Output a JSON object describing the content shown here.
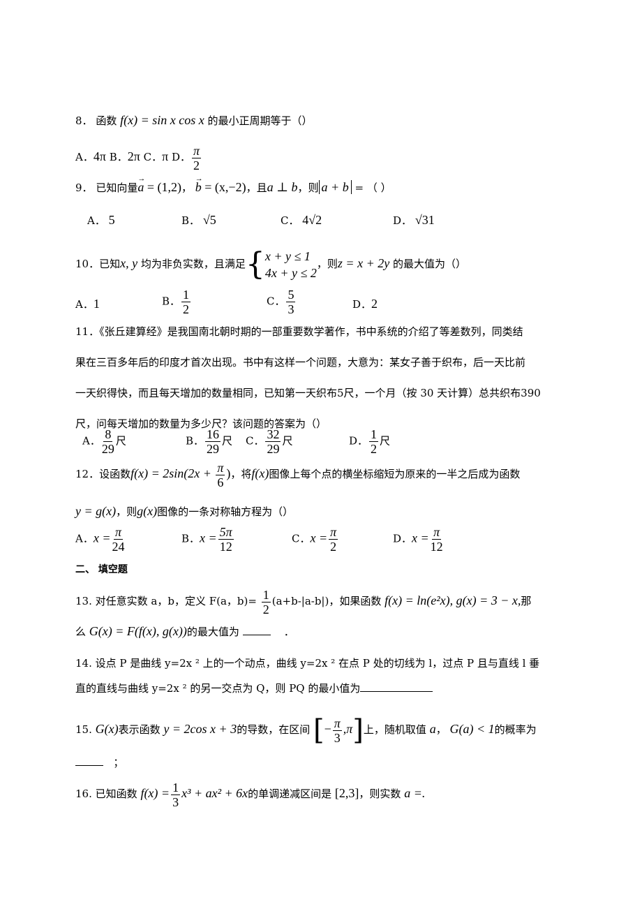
{
  "questions": {
    "q8": {
      "number": "8．",
      "stem_pre": "函数",
      "formula": "f(x) = sin x cos x",
      "stem_post": "的最小正周期等于（）",
      "options": [
        {
          "label": "A．",
          "value": "4π"
        },
        {
          "label": "B．",
          "value": "2π"
        },
        {
          "label": "C．",
          "value": "π"
        },
        {
          "label": "D．",
          "num": "π",
          "den": "2"
        }
      ]
    },
    "q9": {
      "number": "9．",
      "stem_pre": "已知向量",
      "vec_a": "a",
      "vec_a_val": " = (1,2)",
      "sep1": "，",
      "vec_b": "b",
      "vec_b_val": " = (x,−2)",
      "cond_pre": "，且",
      "cond": "a ⊥ b",
      "cond_post": "，则",
      "abs_expr": "a + b",
      "stem_post": " = （        ）",
      "options": [
        {
          "label": "A．",
          "value": "5"
        },
        {
          "label": "B．",
          "value": "√5"
        },
        {
          "label": "C．",
          "value": "4√2"
        },
        {
          "label": "D．",
          "value": "√31"
        }
      ]
    },
    "q10": {
      "number": "10．",
      "stem_pre": "已知",
      "vars": "x, y",
      "stem_mid": "均为非负实数，且满足",
      "system": [
        "x + y ≤ 1",
        "4x + y ≤ 2"
      ],
      "stem_mid2": "，则",
      "objective": "z = x + 2y",
      "stem_post": "的最大值为（）",
      "options": [
        {
          "label": "A．",
          "value": "1"
        },
        {
          "label": "B．",
          "num": "1",
          "den": "2"
        },
        {
          "label": "C．",
          "num": "5",
          "den": "3"
        },
        {
          "label": "D．",
          "value": "2"
        }
      ]
    },
    "q11": {
      "number": "11．",
      "lines": [
        "《张丘建算经》是我国南北朝时期的一部重要数学著作，书中系统的介绍了等差数列，同类结",
        "果在三百多年后的印度才首次出现。书中有这样一个问题，大意为：某女子善于织布，后一天比前",
        "一天织得快，而且每天增加的数量相同，已知第一天织布5尺，一个月（按 30 天计算）总共织布390",
        "尺，问每天增加的数量为多少尺？该问题的答案为（）"
      ],
      "options": [
        {
          "label": "A．",
          "num": "8",
          "den": "29",
          "unit": "尺"
        },
        {
          "label": "B．",
          "num": "16",
          "den": "29",
          "unit": "尺"
        },
        {
          "label": "C．",
          "num": "32",
          "den": "29",
          "unit": "尺"
        },
        {
          "label": "D．",
          "num": "1",
          "den": "2",
          "unit": "尺"
        }
      ]
    },
    "q12": {
      "number": "12．",
      "stem_pre": "设函数",
      "formula_pre": "f(x) = 2sin(2x + ",
      "formula_num": "π",
      "formula_den": "6",
      "formula_post": ")",
      "stem_mid": "，将",
      "fx": "f(x)",
      "stem_post": "图像上每个点的横坐标缩短为原来的一半之后成为函数",
      "line2_formula": "y = g(x)",
      "line2_mid": "，则",
      "line2_gx": "g(x)",
      "line2_post": "图像的一条对称轴方程为（）",
      "options": [
        {
          "label": "A．",
          "pre": "x =",
          "num": "π",
          "den": "24"
        },
        {
          "label": "B．",
          "pre": "x =",
          "num": "5π",
          "den": "12"
        },
        {
          "label": "C．",
          "pre": "x =",
          "num": "π",
          "den": "2"
        },
        {
          "label": "D．",
          "pre": "x =",
          "num": "π",
          "den": "12"
        }
      ]
    }
  },
  "section2": {
    "title": "二、  填空题"
  },
  "fill": {
    "q13": {
      "number": "13.",
      "stem_pre": "对任意实数 a，b，定义 F(a，b)=",
      "frac_num": "1",
      "frac_den": "2",
      "stem_mid": "(a+b-|a-b|)，如果函数",
      "formula": "f(x) = ln(e²x), g(x) = 3 − x,",
      "stem_post": "那",
      "line2_pre": "么",
      "line2_formula": "G(x) = F(f(x), g(x))",
      "line2_post": "的最大值为",
      "line2_end": "．"
    },
    "q14": {
      "number": "14.",
      "line1": "设点 P 是曲线 y=2x ² 上的一个动点，曲线 y=2x ² 在点 P 处的切线为 l，过点 P 且与直线 l 垂",
      "line2": "直的直线与曲线 y=2x ² 的另一交点为 Q，则 PQ 的最小值为"
    },
    "q15": {
      "number": "15.",
      "gx": "G(x)",
      "stem_pre": "表示函数",
      "formula": "y = 2cos x + 3",
      "stem_mid": "的导数，在区间",
      "interval_num": "π",
      "interval_den": "3",
      "interval_end": "π",
      "stem_mid2": "上，随机取值",
      "var": "a",
      "sep": "，",
      "cond": "G(a) < 1",
      "stem_post": "的概率为",
      "line2_end": "；"
    },
    "q16": {
      "number": "16.",
      "stem_pre": "已知函数",
      "formula_pre": "f(x) =",
      "frac_num": "1",
      "frac_den": "3",
      "formula_post": "x³ + ax² + 6x",
      "stem_mid": "的单调递减区间是",
      "interval": "[2,3]",
      "stem_post": "，则实数",
      "tail": "a =."
    }
  }
}
